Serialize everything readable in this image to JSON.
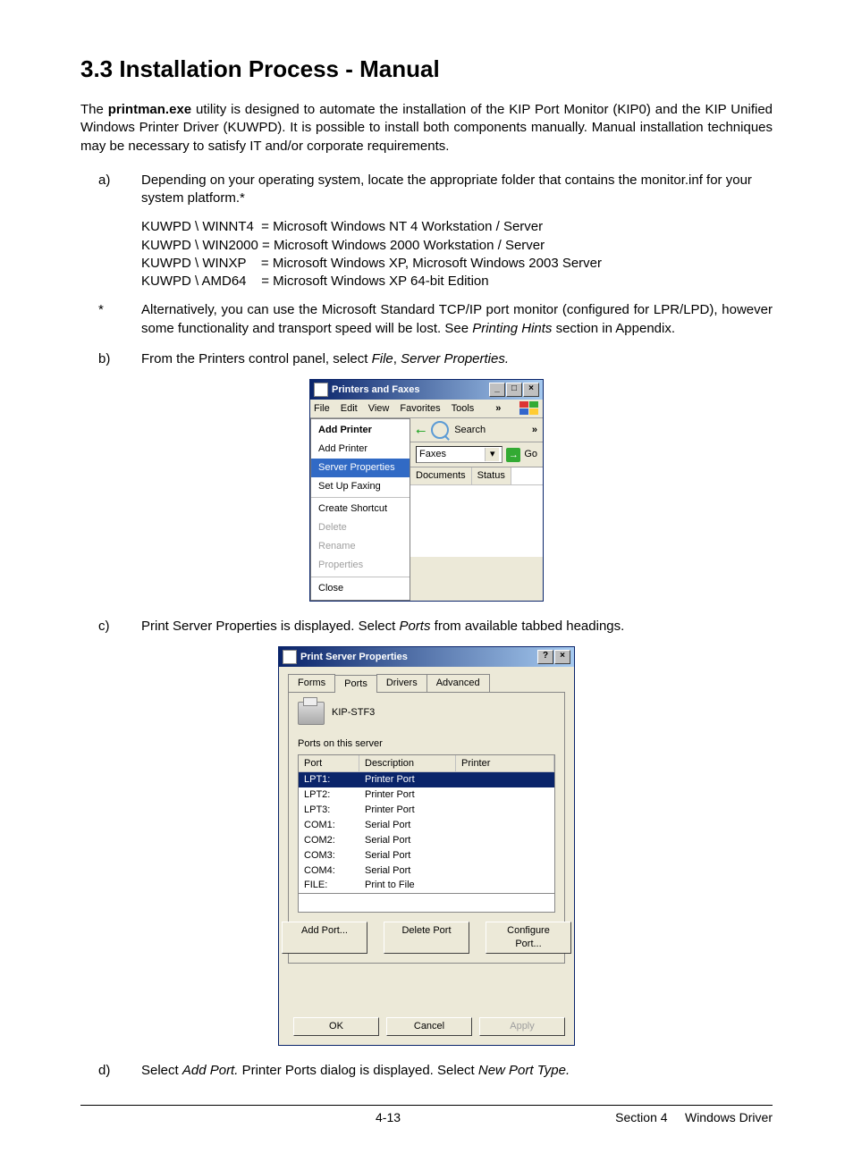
{
  "heading": "3.3 Installation Process - Manual",
  "intro_pre": "The ",
  "intro_bold": "printman.exe",
  "intro_post": " utility is designed to automate the installation of the KIP Port Monitor (KIP0) and the KIP Unified Windows Printer Driver (KUWPD). It is possible to install both components manually. Manual installation techniques may be necessary to satisfy IT and/or corporate requirements.",
  "item_a_label": "a)",
  "item_a_text": "Depending on your operating system, locate the appropriate folder that contains the monitor.inf for your system platform.*",
  "paths": "KUWPD \\ WINNT4  = Microsoft Windows NT 4 Workstation / Server\nKUWPD \\ WIN2000 = Microsoft Windows 2000 Workstation / Server\nKUWPD \\ WINXP    = Microsoft Windows XP, Microsoft Windows 2003 Server\nKUWPD \\ AMD64    = Microsoft Windows XP 64-bit Edition",
  "item_star_label": "*",
  "item_star_pre": "Alternatively, you can use the Microsoft Standard TCP/IP port monitor (configured for LPR/LPD), however some functionality and transport speed will be lost. See ",
  "item_star_italic": "Printing Hints",
  "item_star_post": " section in Appendix.",
  "item_b_label": "b)",
  "item_b_pre": "From the Printers control panel, select ",
  "item_b_i1": "File",
  "item_b_mid": ", ",
  "item_b_i2": "Server Properties.",
  "pf": {
    "title": "Printers and Faxes",
    "menus": [
      "File",
      "Edit",
      "View",
      "Favorites",
      "Tools"
    ],
    "more": "»",
    "search": "Search",
    "tb_more": "»",
    "addr_value": "Faxes",
    "go": "Go",
    "cols": [
      "Documents",
      "Status"
    ],
    "menu_hdr": "Add Printer",
    "menu_items": [
      {
        "t": "Add Printer",
        "cls": ""
      },
      {
        "t": "Server Properties",
        "cls": "sel"
      },
      {
        "t": "Set Up Faxing",
        "cls": ""
      },
      {
        "sep": true
      },
      {
        "t": "Create Shortcut",
        "cls": ""
      },
      {
        "t": "Delete",
        "cls": "dis"
      },
      {
        "t": "Rename",
        "cls": "dis"
      },
      {
        "t": "Properties",
        "cls": "dis"
      },
      {
        "sep": true
      },
      {
        "t": "Close",
        "cls": ""
      }
    ]
  },
  "item_c_label": "c)",
  "item_c_pre": "Print Server Properties is displayed. Select ",
  "item_c_italic": "Ports",
  "item_c_post": " from available tabbed headings.",
  "psp": {
    "title": "Print Server Properties",
    "tabs": [
      "Forms",
      "Ports",
      "Drivers",
      "Advanced"
    ],
    "server": "KIP-STF3",
    "ports_label": "Ports on this server",
    "headers": [
      "Port",
      "Description",
      "Printer"
    ],
    "rows": [
      {
        "p": "LPT1:",
        "d": "Printer Port",
        "sel": true
      },
      {
        "p": "LPT2:",
        "d": "Printer Port"
      },
      {
        "p": "LPT3:",
        "d": "Printer Port"
      },
      {
        "p": "COM1:",
        "d": "Serial Port"
      },
      {
        "p": "COM2:",
        "d": "Serial Port"
      },
      {
        "p": "COM3:",
        "d": "Serial Port"
      },
      {
        "p": "COM4:",
        "d": "Serial Port"
      },
      {
        "p": "FILE:",
        "d": "Print to File"
      }
    ],
    "btn_add": "Add Port...",
    "btn_del": "Delete Port",
    "btn_cfg": "Configure Port...",
    "btn_ok": "OK",
    "btn_cancel": "Cancel",
    "btn_apply": "Apply"
  },
  "item_d_label": "d)",
  "item_d_pre": "Select ",
  "item_d_i1": "Add Port.",
  "item_d_mid": " Printer Ports dialog is displayed. Select ",
  "item_d_i2": "New Port Type.",
  "footer_page": "4-13",
  "footer_section": "Section 4     Windows Driver"
}
